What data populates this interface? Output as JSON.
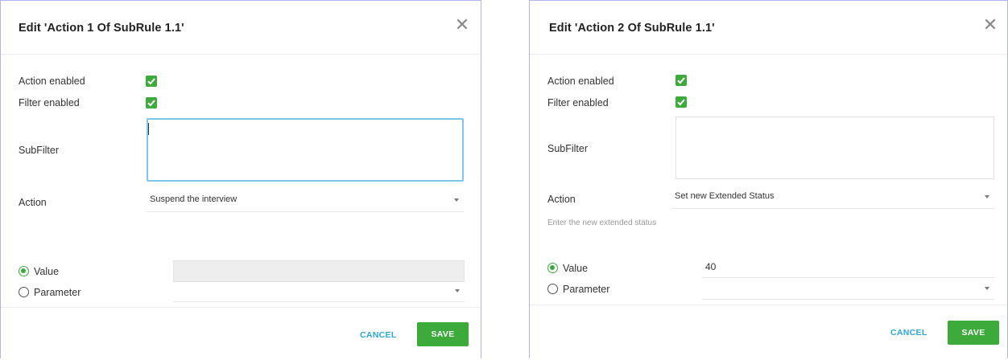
{
  "colors": {
    "accent_green": "#3cab3c",
    "link_blue": "#2aa7d8",
    "focus_border": "#7cc6ea"
  },
  "dialogs": [
    {
      "title": "Edit 'Action 1 Of SubRule 1.1'",
      "close_icon": "close-icon",
      "action_enabled_label": "Action enabled",
      "action_enabled": true,
      "filter_enabled_label": "Filter enabled",
      "filter_enabled": true,
      "subfilter_label": "SubFilter",
      "subfilter_value": "",
      "action_label": "Action",
      "action_value": "Suspend the interview",
      "hint": "",
      "value_radio_label": "Value",
      "value_radio_selected": true,
      "value_field": "",
      "parameter_radio_label": "Parameter",
      "parameter_value": "",
      "cancel_label": "CANCEL",
      "save_label": "SAVE"
    },
    {
      "title": "Edit 'Action 2 Of SubRule 1.1'",
      "close_icon": "close-icon",
      "action_enabled_label": "Action enabled",
      "action_enabled": true,
      "filter_enabled_label": "Filter enabled",
      "filter_enabled": true,
      "subfilter_label": "SubFilter",
      "subfilter_value": "",
      "action_label": "Action",
      "action_value": "Set new Extended Status",
      "hint": "Enter the new extended status",
      "value_radio_label": "Value",
      "value_radio_selected": true,
      "value_field": "40",
      "parameter_radio_label": "Parameter",
      "parameter_value": "",
      "cancel_label": "CANCEL",
      "save_label": "SAVE"
    }
  ]
}
